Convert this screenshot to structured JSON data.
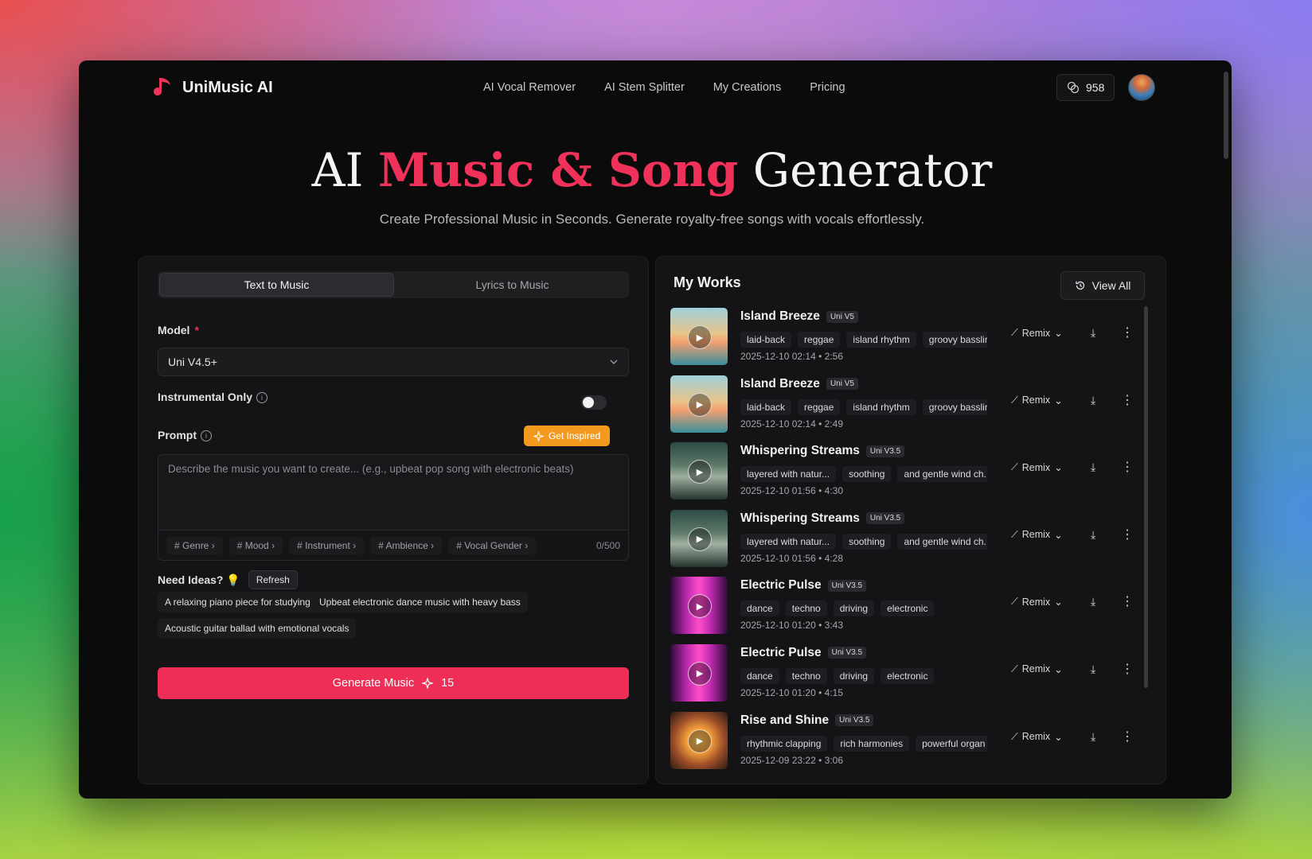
{
  "header": {
    "logo_text": "UniMusic AI",
    "nav": [
      "AI Vocal Remover",
      "AI Stem Splitter",
      "My Creations",
      "Pricing"
    ],
    "credits": "958"
  },
  "hero": {
    "title_pre": "AI ",
    "title_accent": "Music & Song",
    "title_post": " Generator",
    "subtitle": "Create Professional Music in Seconds. Generate royalty-free songs with vocals effortlessly."
  },
  "left": {
    "tabs": [
      "Text to Music",
      "Lyrics to Music"
    ],
    "model_label": "Model",
    "required_mark": "*",
    "model_value": "Uni V4.5+",
    "instrumental_label": "Instrumental Only",
    "instrumental_on": false,
    "prompt_label": "Prompt",
    "get_inspired": "Get Inspired",
    "prompt_placeholder": "Describe the music you want to create... (e.g., upbeat pop song with electronic beats)",
    "tag_chips": [
      "# Genre",
      "# Mood",
      "# Instrument",
      "# Ambience",
      "# Vocal Gender"
    ],
    "char_count": "0/500",
    "ideas_label": "Need Ideas?",
    "refresh": "Refresh",
    "ideas": [
      "A relaxing piano piece for studying",
      "Upbeat electronic dance music with heavy bass",
      "Acoustic guitar ballad with emotional vocals"
    ],
    "generate_label": "Generate Music",
    "generate_cost": "15"
  },
  "works": {
    "title": "My Works",
    "view_all": "View All",
    "remix_label": "Remix",
    "items": [
      {
        "title": "Island Breeze",
        "badge": "Uni V5",
        "tags": [
          "laid-back",
          "reggae",
          "island rhythm",
          "groovy basslir"
        ],
        "date": "2025-12-10 02:14",
        "duration": "2:56",
        "thumb": "beach"
      },
      {
        "title": "Island Breeze",
        "badge": "Uni V5",
        "tags": [
          "laid-back",
          "reggae",
          "island rhythm",
          "groovy basslir"
        ],
        "date": "2025-12-10 02:14",
        "duration": "2:49",
        "thumb": "beach"
      },
      {
        "title": "Whispering Streams",
        "badge": "Uni V3.5",
        "tags": [
          "layered with natur...",
          "soothing",
          "and gentle wind ch."
        ],
        "date": "2025-12-10 01:56",
        "duration": "4:30",
        "thumb": "forest"
      },
      {
        "title": "Whispering Streams",
        "badge": "Uni V3.5",
        "tags": [
          "layered with natur...",
          "soothing",
          "and gentle wind ch."
        ],
        "date": "2025-12-10 01:56",
        "duration": "4:28",
        "thumb": "forest"
      },
      {
        "title": "Electric Pulse",
        "badge": "Uni V3.5",
        "tags": [
          "dance",
          "techno",
          "driving",
          "electronic"
        ],
        "date": "2025-12-10 01:20",
        "duration": "3:43",
        "thumb": "neon"
      },
      {
        "title": "Electric Pulse",
        "badge": "Uni V3.5",
        "tags": [
          "dance",
          "techno",
          "driving",
          "electronic"
        ],
        "date": "2025-12-10 01:20",
        "duration": "4:15",
        "thumb": "neon"
      },
      {
        "title": "Rise and Shine",
        "badge": "Uni V3.5",
        "tags": [
          "rhythmic clapping",
          "rich harmonies",
          "powerful organ"
        ],
        "date": "2025-12-09 23:22",
        "duration": "3:06",
        "thumb": "sun"
      }
    ]
  },
  "colors": {
    "accent": "#f0325a",
    "orange": "#f39a1e"
  }
}
